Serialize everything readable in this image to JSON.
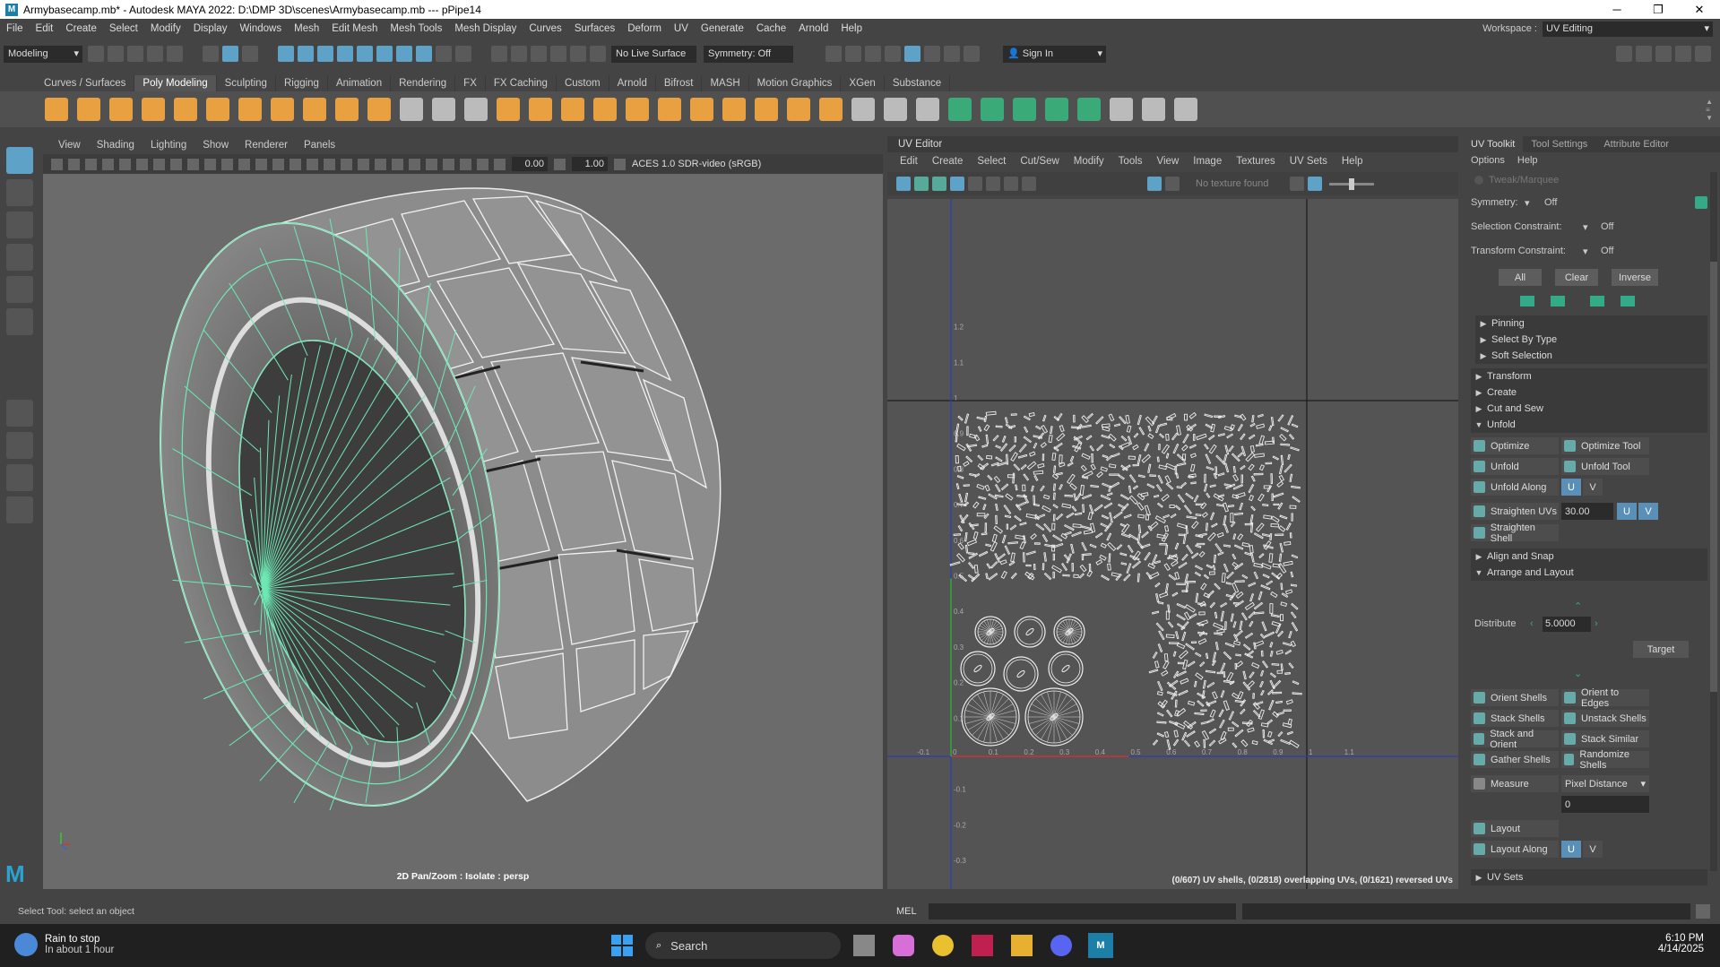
{
  "window": {
    "title": "Armybasecamp.mb* - Autodesk MAYA 2022: D:\\DMP 3D\\scenes\\Armybasecamp.mb   ---   pPipe14",
    "minimize": "─",
    "maximize": "❐",
    "close": "✕"
  },
  "menubar": {
    "items": [
      "File",
      "Edit",
      "Create",
      "Select",
      "Modify",
      "Display",
      "Windows",
      "Mesh",
      "Edit Mesh",
      "Mesh Tools",
      "Mesh Display",
      "Curves",
      "Surfaces",
      "Deform",
      "UV",
      "Generate",
      "Cache",
      "Arnold",
      "Help"
    ],
    "workspace_label": "Workspace :",
    "workspace_value": "UV Editing"
  },
  "statusline": {
    "mode": "Modeling",
    "live_surface": "No Live Surface",
    "symmetry": "Symmetry: Off",
    "sign_in": "Sign In"
  },
  "shelf": {
    "tabs": [
      "Curves / Surfaces",
      "Poly Modeling",
      "Sculpting",
      "Rigging",
      "Animation",
      "Rendering",
      "FX",
      "FX Caching",
      "Custom",
      "Arnold",
      "Bifrost",
      "MASH",
      "Motion Graphics",
      "XGen",
      "Substance"
    ],
    "active": "Poly Modeling"
  },
  "viewport": {
    "menus": [
      "View",
      "Shading",
      "Lighting",
      "Show",
      "Renderer",
      "Panels"
    ],
    "exposure": "0.00",
    "gamma": "1.00",
    "colorspace": "ACES 1.0 SDR-video (sRGB)",
    "label": "2D Pan/Zoom : Isolate : persp"
  },
  "uv_editor": {
    "title": "UV Editor",
    "menus": [
      "Edit",
      "Create",
      "Select",
      "Cut/Sew",
      "Modify",
      "Tools",
      "View",
      "Image",
      "Textures",
      "UV Sets",
      "Help"
    ],
    "texture": "No texture found",
    "status": "(0/607) UV shells, (0/2818) overlapping UVs, (0/1621) reversed UVs",
    "ticks_x": [
      "-0.1",
      "0",
      "0.1",
      "0.2",
      "0.3",
      "0.4",
      "0.5",
      "0.6",
      "0.7",
      "0.8",
      "0.9",
      "1",
      "1.1"
    ],
    "ticks_y": [
      "1.2",
      "1.1",
      "1",
      "0.9",
      "0.8",
      "0.7",
      "0.6",
      "0.5",
      "0.4",
      "0.3",
      "0.2",
      "0.1",
      "0",
      "-0.1",
      "-0.2",
      "-0.3"
    ]
  },
  "toolkit": {
    "tabs": [
      "UV Toolkit",
      "Tool Settings",
      "Attribute Editor"
    ],
    "menus": [
      "Options",
      "Help"
    ],
    "tweak": "Tweak/Marquee",
    "symmetry_label": "Symmetry:",
    "symmetry_value": "Off",
    "selection_constraint_label": "Selection Constraint:",
    "selection_constraint_value": "Off",
    "transform_constraint_label": "Transform Constraint:",
    "transform_constraint_value": "Off",
    "btn_all": "All",
    "btn_clear": "Clear",
    "btn_inverse": "Inverse",
    "sections": {
      "pinning": "Pinning",
      "select_by_type": "Select By Type",
      "soft_selection": "Soft Selection",
      "transform": "Transform",
      "create": "Create",
      "cut_and_sew": "Cut and Sew",
      "unfold": "Unfold",
      "align_and_snap": "Align and Snap",
      "arrange_and_layout": "Arrange and Layout",
      "uv_sets": "UV Sets"
    },
    "optimize": "Optimize",
    "optimize_tool": "Optimize Tool",
    "unfold": "Unfold",
    "unfold_tool": "Unfold Tool",
    "unfold_along": "Unfold Along",
    "u": "U",
    "v": "V",
    "straighten_uvs": "Straighten UVs",
    "straighten_value": "30.00",
    "straighten_shell": "Straighten Shell",
    "distribute_label": "Distribute",
    "distribute_value": "5.0000",
    "target": "Target",
    "orient_shells": "Orient Shells",
    "orient_to_edges": "Orient to Edges",
    "stack_shells": "Stack Shells",
    "unstack_shells": "Unstack Shells",
    "stack_and_orient": "Stack and Orient",
    "stack_similar": "Stack Similar",
    "gather_shells": "Gather Shells",
    "randomize_shells": "Randomize Shells",
    "measure": "Measure",
    "measure_mode": "Pixel Distance",
    "measure_value": "0",
    "layout": "Layout",
    "layout_along": "Layout Along"
  },
  "command": {
    "label": "MEL",
    "help": "Select Tool: select an object"
  },
  "taskbar": {
    "weather_title": "Rain to stop",
    "weather_sub": "In about 1 hour",
    "search": "Search",
    "time": "6:10 PM",
    "date": "4/14/2025"
  },
  "colors": {
    "wire": "#6ee8b4",
    "accent": "#5fa2c8",
    "bg": "#444444"
  }
}
